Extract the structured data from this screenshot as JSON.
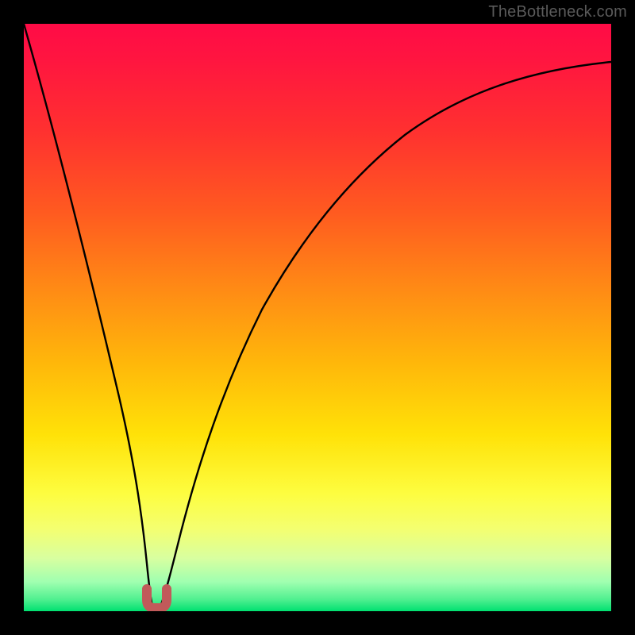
{
  "watermark": "TheBottleneck.com",
  "chart_data": {
    "type": "line",
    "title": "",
    "xlabel": "",
    "ylabel": "",
    "xlim": [
      0,
      100
    ],
    "ylim": [
      0,
      100
    ],
    "series": [
      {
        "name": "bottleneck-curve",
        "x": [
          0,
          3,
          6,
          9,
          12,
          15,
          17,
          19,
          20,
          21,
          22,
          23,
          25,
          27,
          30,
          35,
          40,
          45,
          50,
          55,
          60,
          65,
          70,
          75,
          80,
          85,
          90,
          95,
          100
        ],
        "y": [
          100,
          86,
          72,
          58,
          44,
          30,
          18,
          8,
          3,
          1,
          1,
          3,
          11,
          22,
          35,
          49,
          59,
          66,
          72,
          76,
          80,
          83,
          85,
          87,
          89,
          90,
          91,
          92,
          93
        ]
      }
    ],
    "annotations": [
      {
        "name": "min-marker",
        "x": 21,
        "y": 1,
        "shape": "u",
        "color": "#c15a5a"
      }
    ],
    "background_gradient": {
      "top": "#ff0b46",
      "mid": "#ffe208",
      "bottom": "#00e070"
    }
  }
}
